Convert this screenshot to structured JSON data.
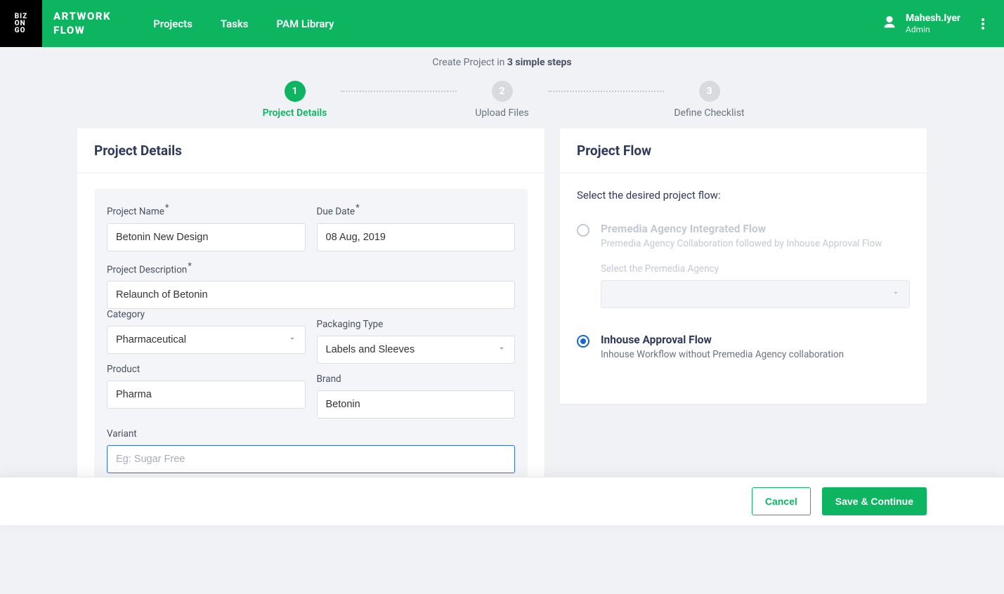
{
  "header": {
    "app_title_line1": "ARTWORK",
    "app_title_line2": "FLOW",
    "nav": [
      "Projects",
      "Tasks",
      "PAM Library"
    ],
    "user": {
      "name": "Mahesh.Iyer",
      "role": "Admin"
    }
  },
  "steps": {
    "title_prefix": "Create Project in ",
    "title_bold": "3 simple steps",
    "items": [
      {
        "num": "1",
        "label": "Project Details",
        "active": true
      },
      {
        "num": "2",
        "label": "Upload Files",
        "active": false
      },
      {
        "num": "3",
        "label": "Define Checklist",
        "active": false
      }
    ]
  },
  "details": {
    "card_title": "Project Details",
    "fields": {
      "project_name": {
        "label": "Project Name",
        "value": "Betonin New Design"
      },
      "due_date": {
        "label": "Due Date",
        "value": "08 Aug, 2019"
      },
      "description": {
        "label": "Project Description",
        "value": "Relaunch of Betonin"
      },
      "category": {
        "label": "Category",
        "value": "Pharmaceutical"
      },
      "packaging_type": {
        "label": "Packaging Type",
        "value": "Labels and Sleeves"
      },
      "product": {
        "label": "Product",
        "value": "Pharma"
      },
      "brand": {
        "label": "Brand",
        "value": "Betonin"
      },
      "variant": {
        "label": "Variant",
        "placeholder": "Eg: Sugar Free",
        "value": ""
      }
    }
  },
  "flow": {
    "card_title": "Project Flow",
    "prompt": "Select the desired project flow:",
    "options": [
      {
        "id": "premedia",
        "title": "Premedia Agency Integrated Flow",
        "desc": "Premedia Agency Collaboration followed by Inhouse Approval Flow",
        "selected": false,
        "disabled": true,
        "sub_label": "Select the Premedia Agency"
      },
      {
        "id": "inhouse",
        "title": "Inhouse Approval Flow",
        "desc": "Inhouse Workflow without Premedia Agency collaboration",
        "selected": true,
        "disabled": false
      }
    ]
  },
  "footer": {
    "cancel": "Cancel",
    "continue": "Save & Continue"
  }
}
